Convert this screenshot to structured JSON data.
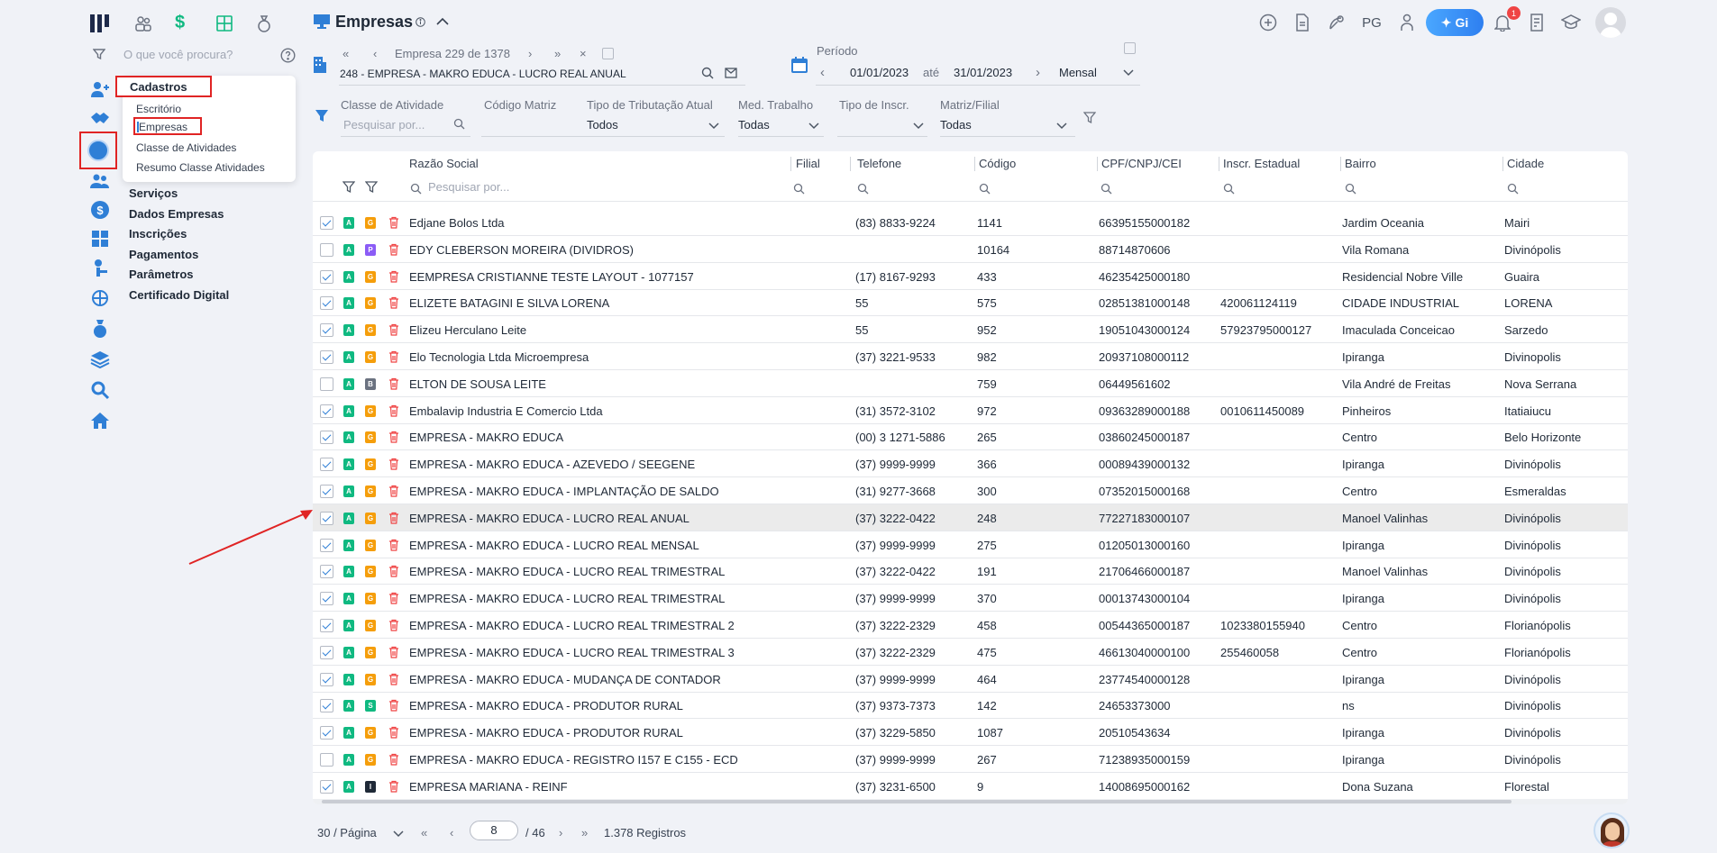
{
  "header": {
    "title": "Empresas",
    "user_initials": "PG",
    "ai_button_label": "Gi",
    "notification_count": "1"
  },
  "sidebar": {
    "search_placeholder": "O que você procura?",
    "menu": [
      "Serviços",
      "Dados Empresas",
      "Inscrições",
      "Pagamentos",
      "Parâmetros",
      "Certificado Digital"
    ],
    "submenu": {
      "title": "Cadastros",
      "items": [
        "Escritório",
        "Empresas",
        "Classe de Atividades",
        "Resumo Classe Atividades"
      ]
    }
  },
  "empresa_nav": {
    "counter": "Empresa 229 de 1378",
    "selected": "248 - EMPRESA - MAKRO EDUCA - LUCRO REAL ANUAL"
  },
  "periodo": {
    "label": "Período",
    "start": "01/01/2023",
    "sep": "até",
    "end": "31/01/2023",
    "mode": "Mensal"
  },
  "filters": {
    "classe_label": "Classe de Atividade",
    "classe_placeholder": "Pesquisar por...",
    "codigo_matriz_label": "Código Matriz",
    "tributacao_label": "Tipo de Tributação Atual",
    "tributacao_value": "Todos",
    "med_trabalho_label": "Med. Trabalho",
    "med_trabalho_value": "Todas",
    "tipo_inscr_label": "Tipo de Inscr.",
    "matriz_filial_label": "Matriz/Filial",
    "matriz_filial_value": "Todas"
  },
  "table": {
    "columns": {
      "razao": "Razão Social",
      "filial": "Filial",
      "telefone": "Telefone",
      "codigo": "Código",
      "cnpj": "CPF/CNPJ/CEI",
      "inscr": "Inscr. Estadual",
      "bairro": "Bairro",
      "cidade": "Cidade"
    },
    "search_placeholder": "Pesquisar por...",
    "rows": [
      {
        "checked": true,
        "tag2": "G",
        "razao": "Edjane Bolos Ltda",
        "telefone": "(83) 8833-9224",
        "codigo": "1141",
        "cnpj": "66395155000182",
        "inscr": "",
        "bairro": "Jardim Oceania",
        "cidade": "Mairi"
      },
      {
        "checked": false,
        "tag2": "P",
        "razao": "EDY CLEBERSON MOREIRA (DIVIDROS)",
        "telefone": "",
        "codigo": "10164",
        "cnpj": "88714870606",
        "inscr": "",
        "bairro": "Vila Romana",
        "cidade": "Divinópolis"
      },
      {
        "checked": true,
        "tag2": "G",
        "razao": "EEMPRESA CRISTIANNE TESTE LAYOUT - 1077157",
        "telefone": "(17) 8167-9293",
        "codigo": "433",
        "cnpj": "46235425000180",
        "inscr": "",
        "bairro": "Residencial Nobre Ville",
        "cidade": "Guaira"
      },
      {
        "checked": true,
        "tag2": "G",
        "razao": "ELIZETE BATAGINI E SILVA LORENA",
        "telefone": "55",
        "codigo": "575",
        "cnpj": "02851381000148",
        "inscr": "420061124119",
        "bairro": "CIDADE INDUSTRIAL",
        "cidade": "LORENA"
      },
      {
        "checked": true,
        "tag2": "G",
        "razao": "Elizeu Herculano Leite",
        "telefone": "55",
        "codigo": "952",
        "cnpj": "19051043000124",
        "inscr": "57923795000127",
        "bairro": "Imaculada Conceicao",
        "cidade": "Sarzedo"
      },
      {
        "checked": true,
        "tag2": "G",
        "razao": "Elo Tecnologia Ltda Microempresa",
        "telefone": "(37) 3221-9533",
        "codigo": "982",
        "cnpj": "20937108000112",
        "inscr": "",
        "bairro": "Ipiranga",
        "cidade": "Divinopolis"
      },
      {
        "checked": false,
        "tag2": "B",
        "razao": "ELTON DE SOUSA LEITE",
        "telefone": "",
        "codigo": "759",
        "cnpj": "06449561602",
        "inscr": "",
        "bairro": "Vila André de Freitas",
        "cidade": "Nova Serrana"
      },
      {
        "checked": true,
        "tag2": "G",
        "razao": "Embalavip Industria E Comercio Ltda",
        "telefone": "(31) 3572-3102",
        "codigo": "972",
        "cnpj": "09363289000188",
        "inscr": "0010611450089",
        "bairro": "Pinheiros",
        "cidade": "Itatiaiucu"
      },
      {
        "checked": true,
        "tag2": "G",
        "razao": "EMPRESA - MAKRO EDUCA",
        "telefone": "(00) 3 1271-5886",
        "codigo": "265",
        "cnpj": "03860245000187",
        "inscr": "",
        "bairro": "Centro",
        "cidade": "Belo Horizonte"
      },
      {
        "checked": true,
        "tag2": "G",
        "razao": "EMPRESA - MAKRO EDUCA - AZEVEDO / SEEGENE",
        "telefone": "(37) 9999-9999",
        "codigo": "366",
        "cnpj": "00089439000132",
        "inscr": "",
        "bairro": "Ipiranga",
        "cidade": "Divinópolis"
      },
      {
        "checked": true,
        "tag2": "G",
        "razao": "EMPRESA - MAKRO EDUCA - IMPLANTAÇÃO DE SALDO",
        "telefone": "(31) 9277-3668",
        "codigo": "300",
        "cnpj": "07352015000168",
        "inscr": "",
        "bairro": "Centro",
        "cidade": "Esmeraldas"
      },
      {
        "checked": true,
        "tag2": "G",
        "razao": "EMPRESA - MAKRO EDUCA - LUCRO REAL ANUAL",
        "telefone": "(37) 3222-0422",
        "codigo": "248",
        "cnpj": "77227183000107",
        "inscr": "",
        "bairro": "Manoel Valinhas",
        "cidade": "Divinópolis",
        "highlight": true
      },
      {
        "checked": true,
        "tag2": "G",
        "razao": "EMPRESA - MAKRO EDUCA - LUCRO REAL MENSAL",
        "telefone": "(37) 9999-9999",
        "codigo": "275",
        "cnpj": "01205013000160",
        "inscr": "",
        "bairro": "Ipiranga",
        "cidade": "Divinópolis"
      },
      {
        "checked": true,
        "tag2": "G",
        "razao": "EMPRESA - MAKRO EDUCA - LUCRO REAL TRIMESTRAL",
        "telefone": "(37) 3222-0422",
        "codigo": "191",
        "cnpj": "21706466000187",
        "inscr": "",
        "bairro": "Manoel Valinhas",
        "cidade": "Divinópolis"
      },
      {
        "checked": true,
        "tag2": "G",
        "razao": "EMPRESA - MAKRO EDUCA - LUCRO REAL TRIMESTRAL",
        "telefone": "(37) 9999-9999",
        "codigo": "370",
        "cnpj": "00013743000104",
        "inscr": "",
        "bairro": "Ipiranga",
        "cidade": "Divinópolis"
      },
      {
        "checked": true,
        "tag2": "G",
        "razao": "EMPRESA - MAKRO EDUCA - LUCRO REAL TRIMESTRAL 2",
        "telefone": "(37) 3222-2329",
        "codigo": "458",
        "cnpj": "00544365000187",
        "inscr": "1023380155940",
        "bairro": "Centro",
        "cidade": "Florianópolis"
      },
      {
        "checked": true,
        "tag2": "G",
        "razao": "EMPRESA - MAKRO EDUCA - LUCRO REAL TRIMESTRAL 3",
        "telefone": "(37) 3222-2329",
        "codigo": "475",
        "cnpj": "46613040000100",
        "inscr": "255460058",
        "bairro": "Centro",
        "cidade": "Florianópolis"
      },
      {
        "checked": true,
        "tag2": "G",
        "razao": "EMPRESA - MAKRO EDUCA - MUDANÇA DE CONTADOR",
        "telefone": "(37) 9999-9999",
        "codigo": "464",
        "cnpj": "23774540000128",
        "inscr": "",
        "bairro": "Ipiranga",
        "cidade": "Divinópolis"
      },
      {
        "checked": true,
        "tag2": "S",
        "razao": "EMPRESA - MAKRO EDUCA - PRODUTOR RURAL",
        "telefone": "(37) 9373-7373",
        "codigo": "142",
        "cnpj": "24653373000",
        "inscr": "",
        "bairro": "ns",
        "cidade": "Divinópolis"
      },
      {
        "checked": true,
        "tag2": "G",
        "razao": "EMPRESA - MAKRO EDUCA - PRODUTOR RURAL",
        "telefone": "(37) 3229-5850",
        "codigo": "1087",
        "cnpj": "20510543634",
        "inscr": "",
        "bairro": "Ipiranga",
        "cidade": "Divinópolis"
      },
      {
        "checked": false,
        "tag2": "G",
        "razao": "EMPRESA - MAKRO EDUCA - REGISTRO I157 E C155 - ECD",
        "telefone": "(37) 9999-9999",
        "codigo": "267",
        "cnpj": "71238935000159",
        "inscr": "",
        "bairro": "Ipiranga",
        "cidade": "Divinópolis"
      },
      {
        "checked": true,
        "tag2": "I",
        "razao": "EMPRESA MARIANA - REINF",
        "telefone": "(37) 3231-6500",
        "codigo": "9",
        "cnpj": "14008695000162",
        "inscr": "",
        "bairro": "Dona Suzana",
        "cidade": "Florestal"
      }
    ]
  },
  "tag_colors": {
    "A": "#10b981",
    "G": "#f59e0b",
    "P": "#8b5cf6",
    "B": "#6b7280",
    "S": "#10b981",
    "I": "#1f2937"
  },
  "pagination": {
    "per_page": "30 / Página",
    "current": "8",
    "total": "/ 46",
    "records": "1.378 Registros"
  },
  "colors": {
    "accent": "#2f7fd6",
    "highlight_box": "#e02424",
    "arrow": "#e02424"
  }
}
